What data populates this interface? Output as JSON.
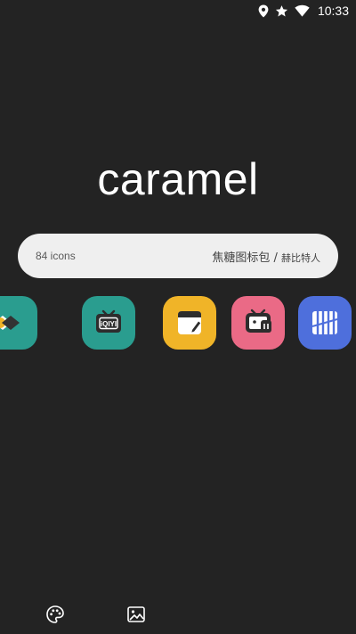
{
  "status_bar": {
    "time": "10:33",
    "icons": [
      "location-icon",
      "star-icon",
      "wifi-icon"
    ]
  },
  "header": {
    "title": "caramel"
  },
  "info": {
    "icon_count": "84 icons",
    "pack_name": "焦糖图标包 / ",
    "author": "赫比特人"
  },
  "icons": [
    {
      "name": "unknown-app-icon",
      "color": "#2a9d8f"
    },
    {
      "name": "iqiyi-icon",
      "color": "#2a9d8f"
    },
    {
      "name": "notes-icon",
      "color": "#f0b428"
    },
    {
      "name": "bilibili-icon",
      "color": "#ea6a86"
    },
    {
      "name": "stripes-app-icon",
      "color": "#4e6fdc"
    }
  ],
  "bottom_nav": [
    "palette-icon",
    "wallpaper-icon"
  ],
  "colors": {
    "background": "#232323",
    "pill": "#efefef",
    "teal": "#2a9d8f",
    "yellow": "#f0b428",
    "pink": "#ea6a86",
    "blue": "#4e6fdc"
  }
}
